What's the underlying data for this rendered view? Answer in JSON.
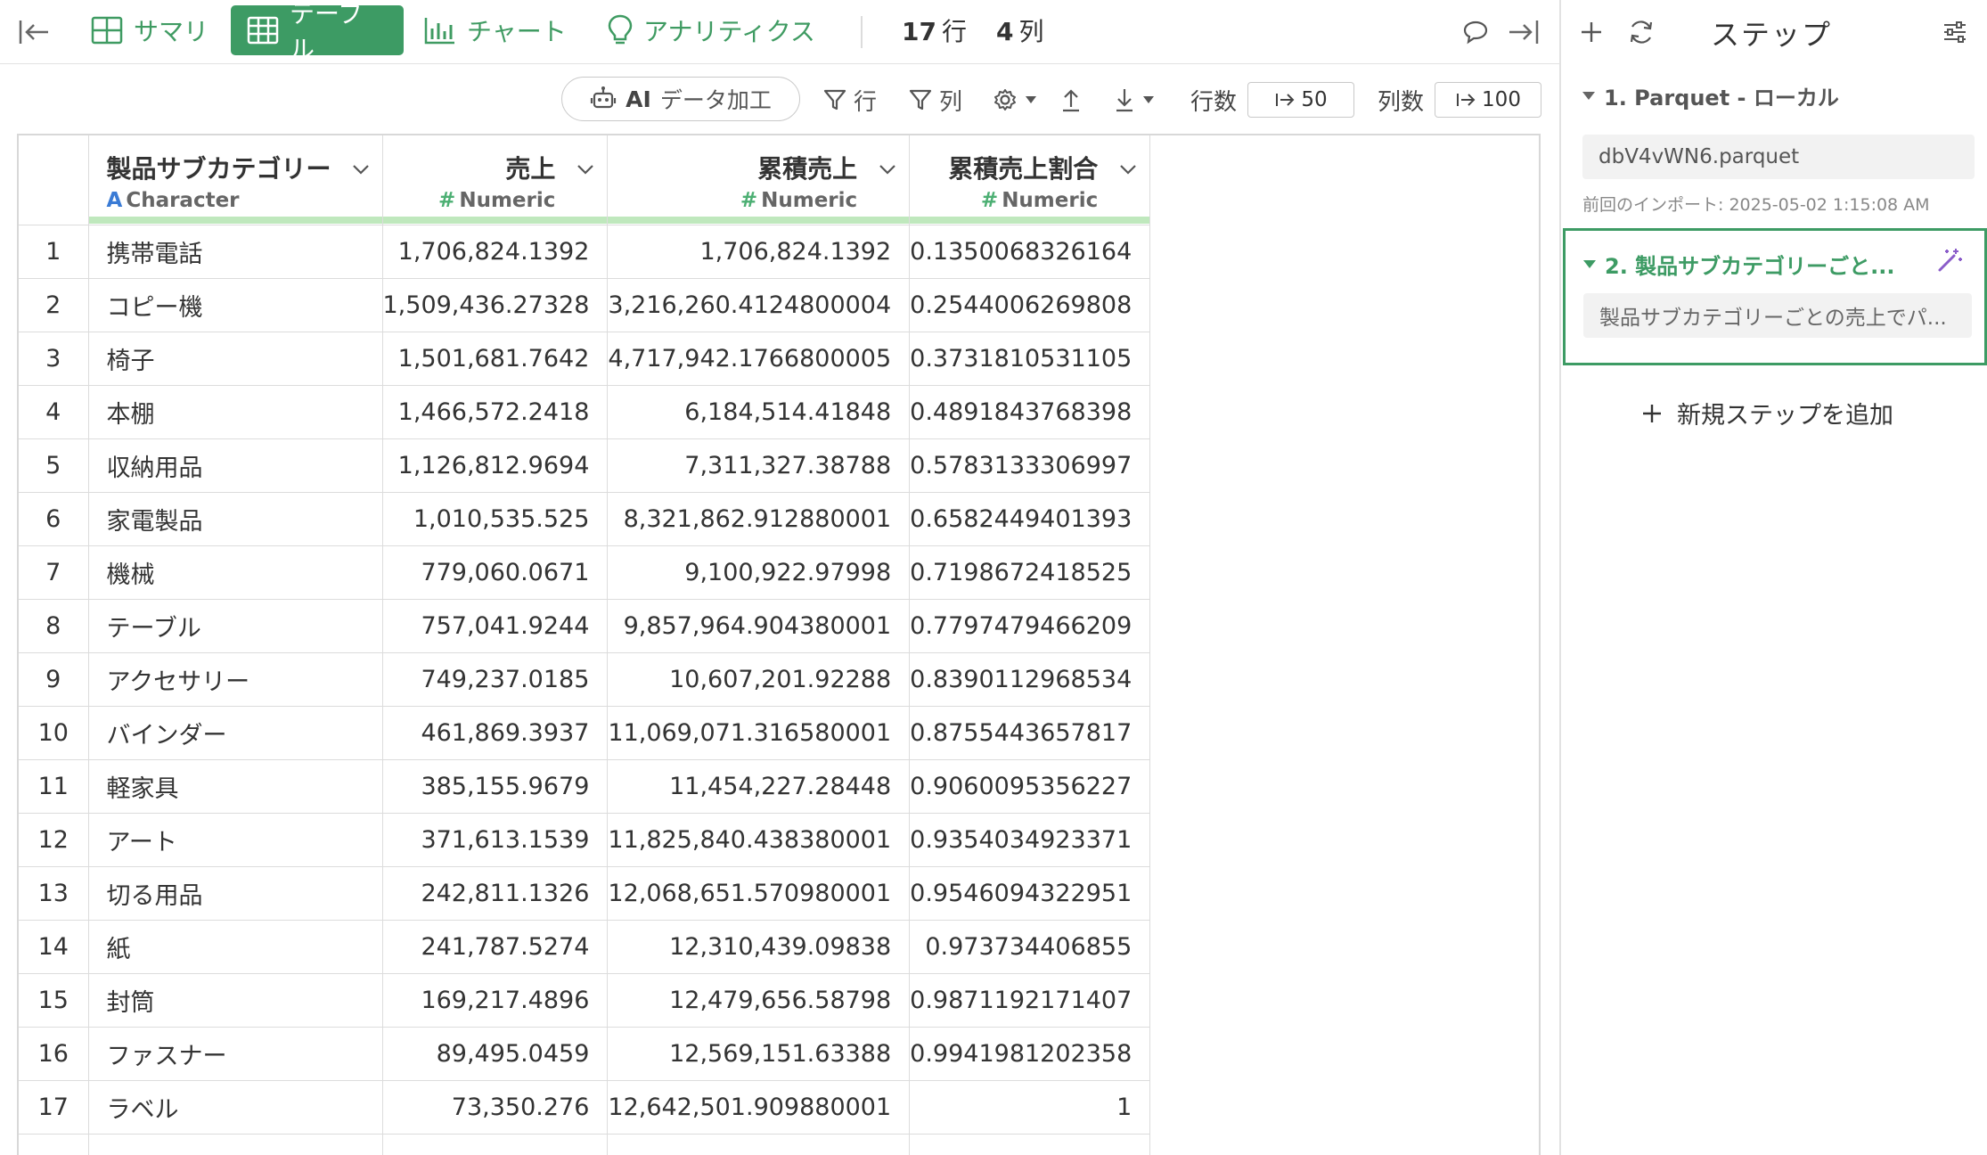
{
  "toolbar": {
    "tabs": [
      {
        "label": "サマリ",
        "icon": "summary-grid-icon"
      },
      {
        "label": "テーブル",
        "icon": "table-icon",
        "active": true
      },
      {
        "label": "チャート",
        "icon": "bar-chart-icon"
      },
      {
        "label": "アナリティクス",
        "icon": "lightbulb-icon"
      }
    ],
    "row_count": "17",
    "row_unit": "行",
    "col_count": "4",
    "col_unit": "列"
  },
  "toolbar2": {
    "ai_label_bold": "AI",
    "ai_label": "データ加工",
    "filter_row_label": "行",
    "filter_col_label": "列",
    "rows_label": "行数",
    "rows_value": "50",
    "cols_label": "列数",
    "cols_value": "100"
  },
  "table": {
    "columns": [
      {
        "name": "製品サブカテゴリー",
        "type_symbol": "A",
        "type": "Character"
      },
      {
        "name": "売上",
        "type_symbol": "#",
        "type": "Numeric"
      },
      {
        "name": "累積売上",
        "type_symbol": "#",
        "type": "Numeric"
      },
      {
        "name": "累積売上割合",
        "type_symbol": "#",
        "type": "Numeric"
      }
    ],
    "rows": [
      [
        "1",
        "携帯電話",
        "1,706,824.1392",
        "1,706,824.1392",
        "0.1350068326164"
      ],
      [
        "2",
        "コピー機",
        "1,509,436.27328",
        "3,216,260.4124800004",
        "0.2544006269808"
      ],
      [
        "3",
        "椅子",
        "1,501,681.7642",
        "4,717,942.1766800005",
        "0.3731810531105"
      ],
      [
        "4",
        "本棚",
        "1,466,572.2418",
        "6,184,514.41848",
        "0.4891843768398"
      ],
      [
        "5",
        "収納用品",
        "1,126,812.9694",
        "7,311,327.38788",
        "0.5783133306997"
      ],
      [
        "6",
        "家電製品",
        "1,010,535.525",
        "8,321,862.912880001",
        "0.6582449401393"
      ],
      [
        "7",
        "機械",
        "779,060.0671",
        "9,100,922.97998",
        "0.7198672418525"
      ],
      [
        "8",
        "テーブル",
        "757,041.9244",
        "9,857,964.904380001",
        "0.7797479466209"
      ],
      [
        "9",
        "アクセサリー",
        "749,237.0185",
        "10,607,201.92288",
        "0.8390112968534"
      ],
      [
        "10",
        "バインダー",
        "461,869.3937",
        "11,069,071.316580001",
        "0.8755443657817"
      ],
      [
        "11",
        "軽家具",
        "385,155.9679",
        "11,454,227.28448",
        "0.9060095356227"
      ],
      [
        "12",
        "アート",
        "371,613.1539",
        "11,825,840.438380001",
        "0.9354034923371"
      ],
      [
        "13",
        "切る用品",
        "242,811.1326",
        "12,068,651.570980001",
        "0.9546094322951"
      ],
      [
        "14",
        "紙",
        "241,787.5274",
        "12,310,439.09838",
        "0.973734406855"
      ],
      [
        "15",
        "封筒",
        "169,217.4896",
        "12,479,656.58798",
        "0.9871192171407"
      ],
      [
        "16",
        "ファスナー",
        "89,495.0459",
        "12,569,151.63388",
        "0.9941981202358"
      ],
      [
        "17",
        "ラベル",
        "73,350.276",
        "12,642,501.909880001",
        "1"
      ]
    ]
  },
  "panel": {
    "title": "ステップ",
    "steps": [
      {
        "label": "1. Parquet - ローカル",
        "detail": "dbV4vWN6.parquet",
        "note": "前回のインポート: 2025-05-02 1:15:08 AM"
      },
      {
        "label": "2. 製品サブカテゴリーごと...",
        "detail": "製品サブカテゴリーごとの売上でパ..."
      }
    ],
    "add_step_label": "新規ステップを追加"
  },
  "colors": {
    "accent": "#3d9b64",
    "header_bar": "#bfe8bd",
    "character_type": "#3a7bd5",
    "numeric_type": "#4caf73",
    "wand": "#8a5cc9"
  }
}
